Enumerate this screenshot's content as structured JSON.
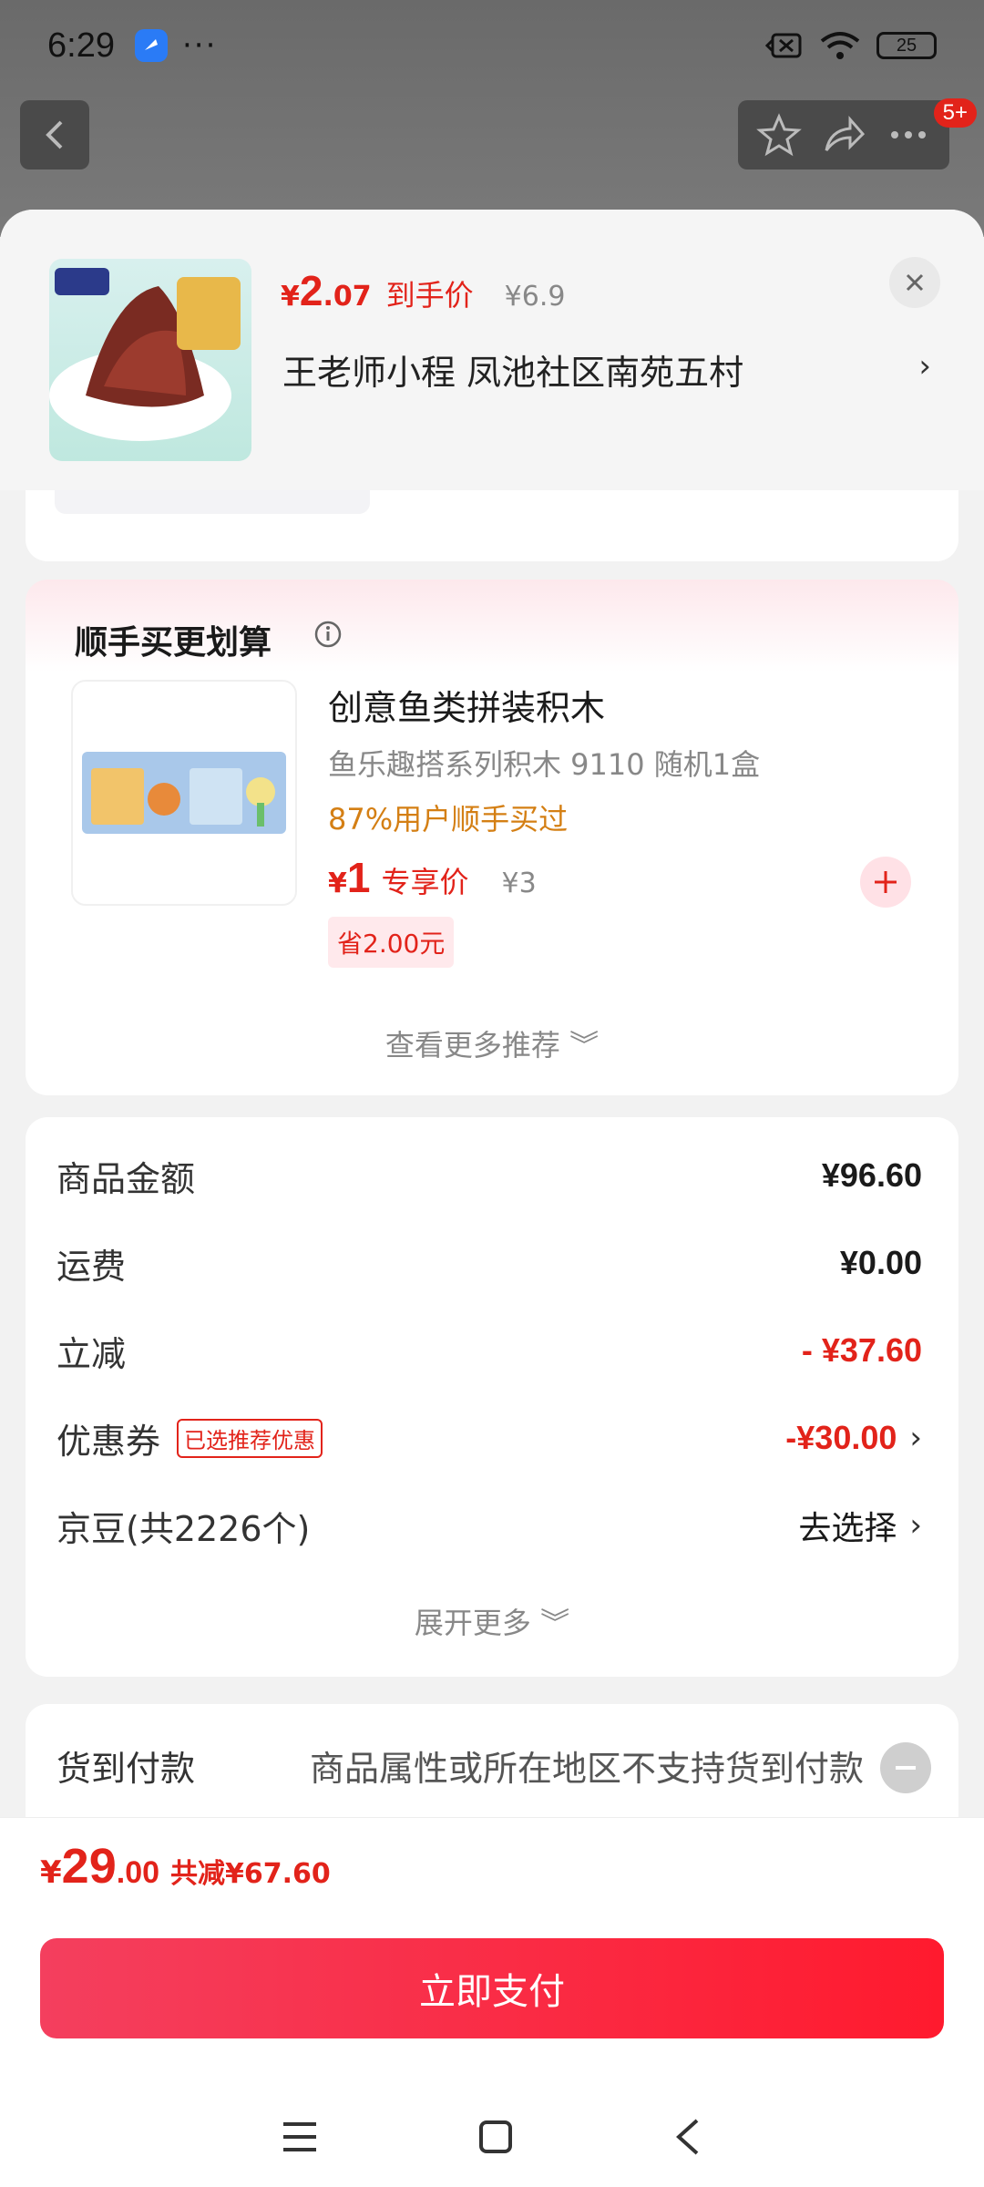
{
  "status_bar": {
    "time": "6:29",
    "dots": "···",
    "battery": "25"
  },
  "top_nav": {
    "badge": "5+"
  },
  "product": {
    "price_yen": "¥",
    "price_int": "2",
    "price_dec": ".07",
    "price_tag": "到手价",
    "price_orig": "¥6.9",
    "shop_line": "王老师小程  凤池社区南苑五村",
    "arrow": "›"
  },
  "recommend": {
    "title": "顺手买更划算",
    "name": "创意鱼类拼装积木",
    "spec": "鱼乐趣搭系列积木 9110 随机1盒",
    "social": "87%用户顺手买过",
    "price_yen": "¥",
    "price": "1",
    "price_tag": "专享价",
    "price_orig": "¥3",
    "save": "省2.00元",
    "more": "查看更多推荐 ︾"
  },
  "summary": {
    "rows": [
      {
        "label": "商品金额",
        "value": "¥96.60"
      },
      {
        "label": "运费",
        "value": "¥0.00"
      },
      {
        "label": "立减",
        "value": "- ¥37.60"
      },
      {
        "label": "优惠券",
        "tag": "已选推荐优惠",
        "value": "-¥30.00",
        "chevron": "›"
      },
      {
        "label": "京豆(共2226个)",
        "value": "去选择",
        "chevron": "›"
      }
    ],
    "expand": "展开更多 ︾"
  },
  "cod": {
    "label": "货到付款",
    "desc": "商品属性或所在地区不支持货到付款"
  },
  "pay": {
    "yen": "¥",
    "int": "29",
    "dec": ".00",
    "saved": "共减¥67.60",
    "button": "立即支付"
  },
  "colors": {
    "accent_red": "#e2231a",
    "orange": "#d47f14",
    "pay_gradient_start": "#f43f5e",
    "pay_gradient_end": "#ff1a2e"
  },
  "icons": [
    "back-arrow-icon",
    "star-icon",
    "share-icon",
    "more-icon",
    "close-icon",
    "info-icon",
    "plus-icon",
    "minus-icon",
    "menu-icon",
    "home-icon",
    "back-icon"
  ]
}
